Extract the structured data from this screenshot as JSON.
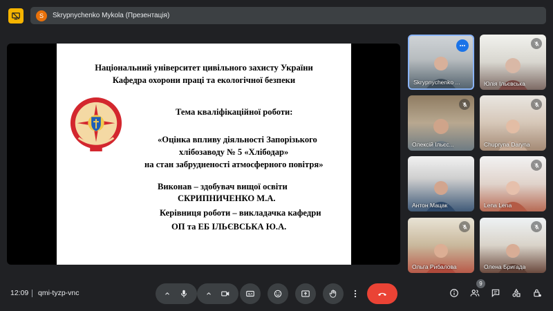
{
  "presentation": {
    "avatar_letter": "S",
    "title": "Skrypnychenko Mykola (Презентація)"
  },
  "slide": {
    "university": "Національний університет цивільного захисту України",
    "department": "Кафедра охорони праці та екологічної безпеки",
    "topic_heading": "Тема кваліфікаційної роботи:",
    "topic_line1": "«Оцінка впливу діяльності Запорізького",
    "topic_line2": "хлібозаводу № 5 «Хлібодар»",
    "topic_line3": "на стан забрудненості атмосферного повітря»",
    "author_line1": "Виконав – здобувач вищої освіти",
    "author_line2": "СКРИПНИЧЕНКО М.А.",
    "supervisor_line1": "Керівниця роботи – викладачка кафедри",
    "supervisor_line2": "ОП та ЕБ ІЛЬЄВСЬКА Ю.А."
  },
  "participants": [
    {
      "name": "Skrypnychenko ...",
      "state": "active-menu"
    },
    {
      "name": "Юлія Ільєвська",
      "state": "muted"
    },
    {
      "name": "Олексій Ільєс...",
      "state": "muted"
    },
    {
      "name": "Chupryna Daryna",
      "state": "muted"
    },
    {
      "name": "Антон Мацак",
      "state": "muted"
    },
    {
      "name": "Lena Lena",
      "state": "muted"
    },
    {
      "name": "Ольга Рибалова",
      "state": "muted"
    },
    {
      "name": "Олена Бригада",
      "state": "muted"
    }
  ],
  "bottom_bar": {
    "time": "12:09",
    "meeting_code": "qmi-tyzp-vnc",
    "people_count": "9"
  },
  "colors": {
    "background": "#202124",
    "control": "#3c4043",
    "end_call": "#ea4335",
    "accent": "#8ab4f8",
    "logo": "#f6b400"
  }
}
